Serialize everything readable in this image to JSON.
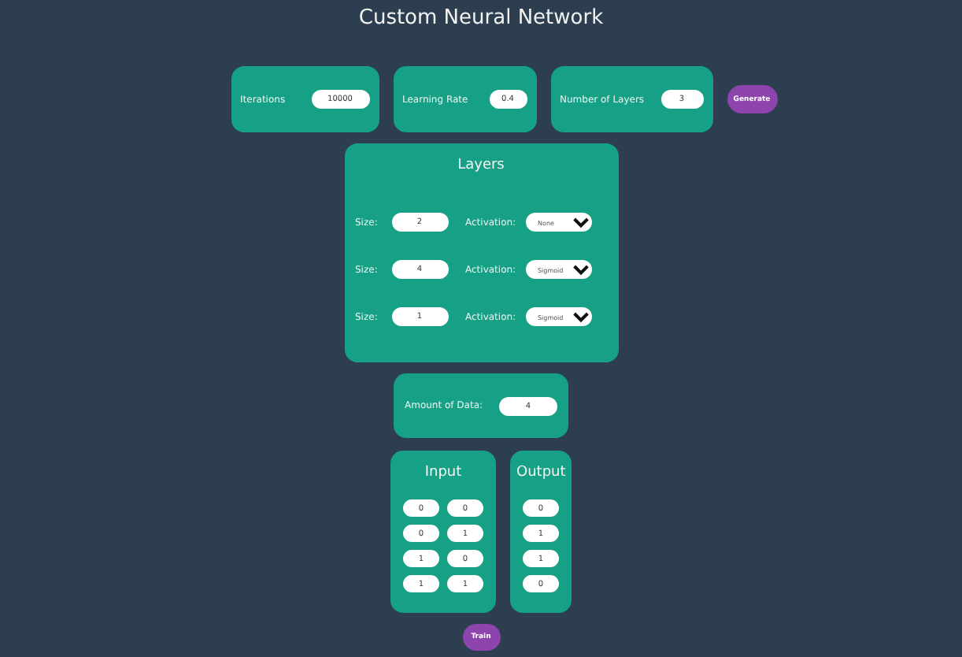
{
  "title": "Custom Neural Network",
  "settings": [
    {
      "label": "Iterations",
      "value": "10000"
    },
    {
      "label": "Learning Rate",
      "value": "0.4"
    },
    {
      "label": "Number of Layers",
      "value": "3"
    }
  ],
  "generate_button": "Generate",
  "layers": {
    "title": "Layers",
    "rows": [
      {
        "size_label": "Size:",
        "size": "2",
        "activation_label": "Activation:",
        "activation": "None"
      },
      {
        "size_label": "Size:",
        "size": "4",
        "activation_label": "Activation:",
        "activation": "Sigmoid"
      },
      {
        "size_label": "Size:",
        "size": "1",
        "activation_label": "Activation:",
        "activation": "Sigmoid"
      }
    ]
  },
  "data_amount": {
    "label": "Amount of Data:",
    "value": "4"
  },
  "input": {
    "title": "Input",
    "rows": [
      [
        "0",
        "0"
      ],
      [
        "0",
        "1"
      ],
      [
        "1",
        "0"
      ],
      [
        "1",
        "1"
      ]
    ]
  },
  "output": {
    "title": "Output",
    "rows": [
      "0",
      "1",
      "1",
      "0"
    ]
  },
  "train_button": "Train"
}
